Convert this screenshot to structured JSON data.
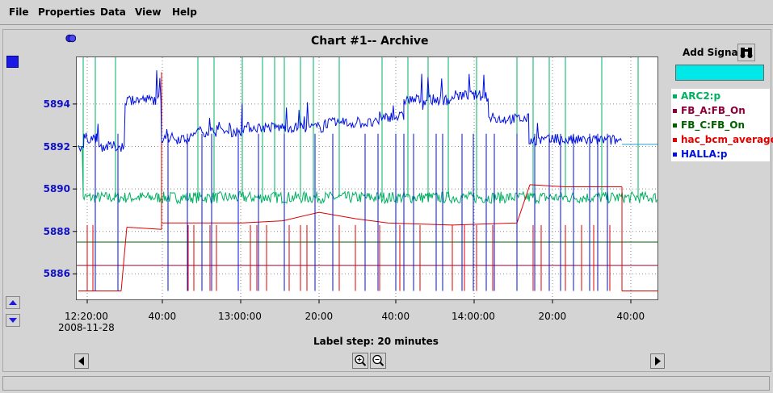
{
  "menu": {
    "file": "File",
    "properties": "Properties",
    "data": "Data",
    "view": "View",
    "help": "Help"
  },
  "chart_title": "Chart #1-- Archive",
  "label_step": "Label step: 20 minutes",
  "add_signal": {
    "label": "Add Signal",
    "input_value": ""
  },
  "icons": {
    "binoculars": "binoculars-icon",
    "zoom_in": "zoom-in-icon",
    "zoom_out": "zoom-out-icon",
    "scroll_left": "arrow-left-icon",
    "scroll_right": "arrow-right-icon",
    "scale_up": "arrow-up-icon",
    "scale_down": "arrow-down-icon",
    "color_marker": "blue-square-icon",
    "dot_marker": "blue-dot-icon"
  },
  "chart_data": {
    "type": "line",
    "title": "Chart #1-- Archive",
    "xlabel": "",
    "ylabel": "",
    "grid": true,
    "legend_position": "right",
    "ylim": [
      5884.8,
      5896.2
    ],
    "xlim": [
      "12:17:00",
      "12:59:30"
    ],
    "y_ticks": [
      "5894",
      "5892",
      "5890",
      "5888",
      "5886"
    ],
    "x_ticks": [
      {
        "label": "12:20:00",
        "sub": "2008-11-28"
      },
      {
        "label": "40:00",
        "sub": ""
      },
      {
        "label": "13:00:00",
        "sub": ""
      },
      {
        "label": "20:00",
        "sub": ""
      },
      {
        "label": "40:00",
        "sub": ""
      },
      {
        "label": "14:00:00",
        "sub": ""
      },
      {
        "label": "20:00",
        "sub": ""
      },
      {
        "label": "40:00",
        "sub": ""
      }
    ],
    "series": [
      {
        "name": "ARC2:p",
        "color": "#00b060"
      },
      {
        "name": "FB_A:FB_On",
        "color": "#8b0038"
      },
      {
        "name": "FB_C:FB_On",
        "color": "#006000"
      },
      {
        "name": "hac_bcm_average",
        "color": "#e00000"
      },
      {
        "name": "HALLA:p",
        "color": "#0010e0"
      }
    ],
    "levels": {
      "ARC2:p": 5889.6,
      "FB_A:FB_On": 5886.4,
      "FB_C:FB_On": 5887.5,
      "hac_bcm_average": 5888.4,
      "HALLA:p": 5892.8
    }
  }
}
